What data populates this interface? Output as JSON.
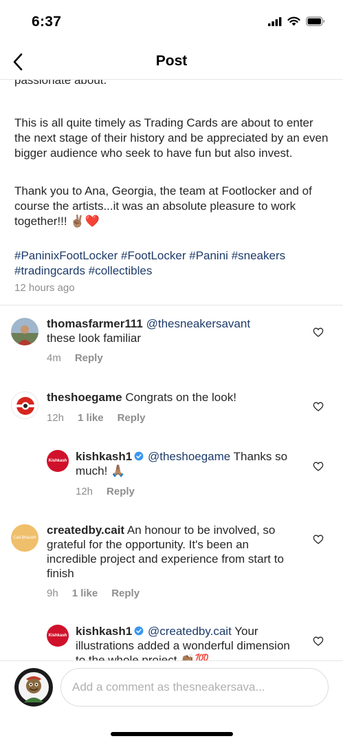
{
  "status_bar": {
    "time": "6:37"
  },
  "header": {
    "title": "Post"
  },
  "caption": {
    "partial_line": "passionate about.",
    "paragraph2": "This is all quite timely as Trading Cards are about to enter the next stage of their history and be appreciated by an even bigger audience who seek to have fun but also invest.",
    "paragraph3": "Thank you to Ana, Georgia, the team at Footlocker and of course the artists...it was an absolute pleasure to work together!!! ✌🏽❤️",
    "hashtags": [
      "#PaninixFootLocker",
      "#FootLocker",
      "#Panini",
      "#sneakers",
      "#tradingcards",
      "#collectibles"
    ],
    "time_ago": "12 hours ago"
  },
  "comments": [
    {
      "username": "thomasfarmer111",
      "mention": "@thesneakersavant",
      "text": "these look familiar",
      "time": "4m",
      "reply_label": "Reply"
    },
    {
      "username": "theshoegame",
      "text": "Congrats on the look!",
      "time": "12h",
      "likes": "1 like",
      "reply_label": "Reply"
    },
    {
      "username": "kishkash1",
      "mention": "@theshoegame",
      "text": "Thanks so much! 🙏🏽",
      "time": "12h",
      "reply_label": "Reply",
      "avatar_text": "Kishkash"
    },
    {
      "username": "createdby.cait",
      "text": "An honour to be involved, so grateful for the opportunity. It's been an incredible project and experience from start to finish",
      "time": "9h",
      "likes": "1 like",
      "reply_label": "Reply",
      "avatar_text": "Cait Bharath"
    },
    {
      "username": "kishkash1",
      "mention": "@createdby.cait",
      "text": "Your illustrations added a wonderful dimension to the whole project 👏🏽💯",
      "avatar_text": "Kishkash"
    }
  ],
  "comment_input": {
    "placeholder": "Add a comment as thesneakersava..."
  },
  "icons": {
    "back": "chevron-left-icon",
    "heart": "heart-outline-icon",
    "verified": "verified-badge-icon"
  },
  "colors": {
    "link": "#1d3b6a",
    "verified": "#3897f0",
    "muted": "#8e8e8e",
    "kishkash_red": "#d0112b"
  }
}
